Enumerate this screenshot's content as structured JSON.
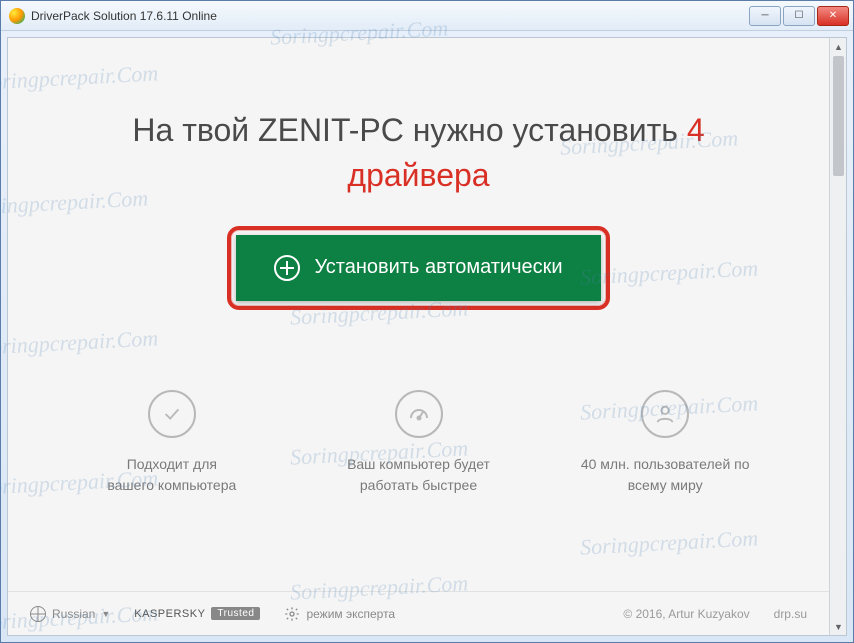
{
  "window": {
    "title": "DriverPack Solution 17.6.11 Online"
  },
  "headline": {
    "prefix": "На твой ZENIT-PC нужно установить",
    "count": "4",
    "drivers_word": "драйвера"
  },
  "install_button": {
    "label": "Установить автоматически"
  },
  "features": [
    {
      "text": "Подходит для\nвашего компьютера"
    },
    {
      "text": "Ваш компьютер будет\nработать быстрее"
    },
    {
      "text": "40 млн. пользователей по\nвсему миру"
    }
  ],
  "footer": {
    "language": "Russian",
    "kaspersky_brand": "KASPERSKY",
    "trusted_label": "Trusted",
    "expert_mode": "режим эксперта",
    "copyright": "© 2016, Artur Kuzyakov",
    "site": "drp.su"
  },
  "watermark": "Soringpcrepair.Com"
}
